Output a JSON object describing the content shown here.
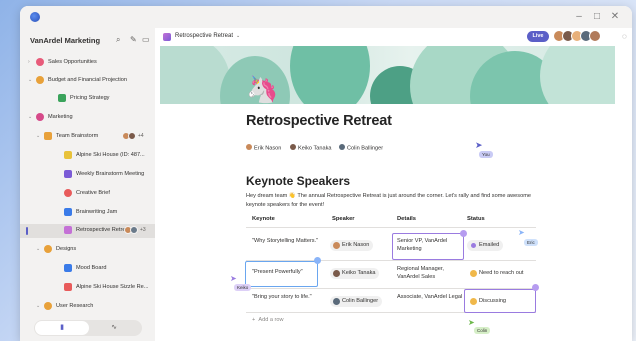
{
  "window": {
    "app_icon": "app-logo-icon",
    "controls": [
      "–",
      "□",
      "✕"
    ]
  },
  "sidebar": {
    "workspace_title": "VanArdel Marketing",
    "items": [
      {
        "label": "Sales Opportunities",
        "icon": "heart-icon",
        "color": "#e85b7a",
        "level": 0
      },
      {
        "label": "Budget and Financial Projection",
        "icon": "money-bag-icon",
        "color": "#e8a13a",
        "level": 0
      },
      {
        "label": "Pricing Strategy",
        "icon": "chart-icon",
        "color": "#3aa35b",
        "level": 1
      },
      {
        "label": "Marketing",
        "icon": "pin-icon",
        "color": "#d64a8a",
        "level": 0
      },
      {
        "label": "Team Brainstorm",
        "icon": "bulb-icon",
        "color": "#e8a13a",
        "level": 1
      },
      {
        "label": "Alpine Ski House (ID: 487...",
        "icon": "ski-icon",
        "color": "#e8c23a",
        "level": 2
      },
      {
        "label": "Weekly Brainstorm Meeting",
        "icon": "calendar-icon",
        "color": "#7b5bd6",
        "level": 2
      },
      {
        "label": "Creative Brief",
        "icon": "palette-icon",
        "color": "#e85b5b",
        "level": 2
      },
      {
        "label": "Brainwriting Jam",
        "icon": "pencil-icon",
        "color": "#3a7be8",
        "level": 2
      },
      {
        "label": "Retrospective Retre...",
        "icon": "unicorn-icon",
        "color": "#c471d6",
        "level": 2
      },
      {
        "label": "Designs",
        "icon": "sparkle-icon",
        "color": "#e8a13a",
        "level": 1
      },
      {
        "label": "Mood Board",
        "icon": "pencil-icon",
        "color": "#3a7be8",
        "level": 2
      },
      {
        "label": "Alpine Ski House Sizzle Re...",
        "icon": "video-icon",
        "color": "#e85b5b",
        "level": 2
      },
      {
        "label": "User Research",
        "icon": "pin-icon",
        "color": "#e8a13a",
        "level": 1
      }
    ],
    "team_count": "+4",
    "retro_count": "+3",
    "tabs": {
      "left_icon": "document-icon",
      "right_icon": "activity-icon"
    }
  },
  "header": {
    "breadcrumb": "Retrospective Retreat",
    "live_label": "Live",
    "share_icon": "comment-icon"
  },
  "doc": {
    "emoji": "🦄",
    "title": "Retrospective Retreat",
    "authors": [
      "Erik Nason",
      "Keiko Tanaka",
      "Colin Ballinger"
    ],
    "heading": "Keynote Speakers",
    "paragraph": "Hey dream team 👋 The annual Retrospective Retreat is just around the corner. Let's rally and find some awesome keynote speakers for the event!",
    "table": {
      "headers": [
        "Keynote",
        "Speaker",
        "Details",
        "Status"
      ],
      "rows": [
        {
          "keynote": "\"Why Storytelling Matters.\"",
          "speaker": "Erik Nason",
          "details": "Senior VP, VanArdel Marketing",
          "status": "Emailed"
        },
        {
          "keynote": "\"Present Powerfully\"",
          "speaker": "Keiko Tanaka",
          "details": "Regional Manager, VanArdel Sales",
          "status": "Need to reach out"
        },
        {
          "keynote": "\"Bring your story to life.\"",
          "speaker": "Colin Ballinger",
          "details": "Associate, VanArdel Legal",
          "status": "Discussing"
        }
      ],
      "add_row": "Add a row"
    }
  },
  "cursors": [
    {
      "name": "You",
      "color": "#5b5fc7"
    },
    {
      "name": "Eric",
      "color": "#8ab4f8"
    },
    {
      "name": "Keiko",
      "color": "#b69cf0"
    },
    {
      "name": "Colin",
      "color": "#9ad17a"
    }
  ],
  "colors": {
    "accent": "#5b5fc7",
    "sidebar_bg": "#f3f2f1",
    "selection_blue": "#6aa6ef",
    "selection_purple": "#9a7be0"
  }
}
